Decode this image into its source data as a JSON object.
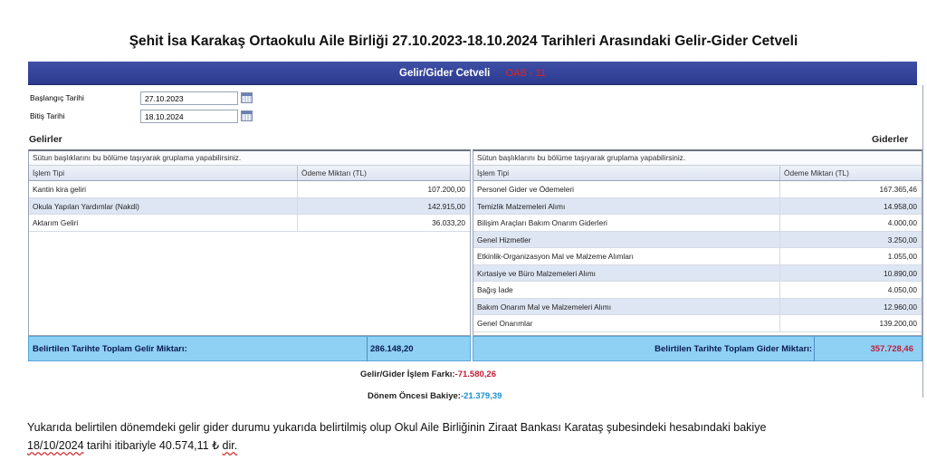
{
  "title": "Şehit İsa Karakaş Ortaokulu Aile Birliği 27.10.2023-18.10.2024 Tarihleri Arasındaki Gelir-Gider Cetveli",
  "header": {
    "label": "Gelir/Gider Cetveli",
    "badge": "OAB - 11"
  },
  "filters": {
    "start": {
      "label": "Başlangıç Tarihi",
      "value": "27.10.2023"
    },
    "end": {
      "label": "Bitiş Tarihi",
      "value": "18.10.2024"
    }
  },
  "income": {
    "heading": "Gelirler",
    "group_hint": "Sütun başlıklarını bu bölüme taşıyarak gruplama yapabilirsiniz.",
    "columns": [
      "İşlem Tipi",
      "Ödeme Miktarı (TL)"
    ],
    "rows": [
      {
        "type": "Kantin kira geliri",
        "amount": "107.200,00"
      },
      {
        "type": "Okula Yapılan Yardımlar (Nakdi)",
        "amount": "142.915,00"
      },
      {
        "type": "Aktarım Geliri",
        "amount": "36.033,20"
      }
    ],
    "total_label": "Belirtilen Tarihte Toplam Gelir Miktarı:",
    "total_value": "286.148,20"
  },
  "expense": {
    "heading": "Giderler",
    "group_hint": "Sütun başlıklarını bu bölüme taşıyarak gruplama yapabilirsiniz.",
    "columns": [
      "İşlem Tipi",
      "Ödeme Miktarı (TL)"
    ],
    "rows": [
      {
        "type": "Personel Gider ve Ödemeleri",
        "amount": "167.365,46"
      },
      {
        "type": "Temizlik Malzemeleri Alımı",
        "amount": "14.958,00"
      },
      {
        "type": "Bilişim Araçları Bakım Onarım Giderleri",
        "amount": "4.000,00"
      },
      {
        "type": "Genel Hizmetler",
        "amount": "3.250,00"
      },
      {
        "type": "Etkinlik-Organizasyon Mal ve Malzeme Alımları",
        "amount": "1.055,00"
      },
      {
        "type": "Kırtasiye ve Büro Malzemeleri Alımı",
        "amount": "10.890,00"
      },
      {
        "type": "Bağış İade",
        "amount": "4.050,00"
      },
      {
        "type": "Bakım Onarım Mal ve Malzemeleri Alımı",
        "amount": "12.960,00"
      },
      {
        "type": "Genel Onarımlar",
        "amount": "139.200,00"
      }
    ],
    "total_label": "Belirtilen Tarihte Toplam Gider Miktarı:",
    "total_value": "357.728,46"
  },
  "summary": {
    "diff_label": "Gelir/Gider İşlem Farkı:",
    "diff_value": "-71.580,26",
    "prev_label": "Dönem Öncesi Bakiye:",
    "prev_value": "-21.379,39"
  },
  "note": {
    "line1": "Yukarıda belirtilen dönemdeki gelir gider durumu yukarıda belirtilmiş olup Okul Aile Birliğinin Ziraat Bankası Karataş şubesindeki hesabındaki bakiye",
    "date": "18/10/2024",
    "line2_mid": " tarihi itibariyle 40.574,11 ₺ ",
    "line2_end": "dir."
  },
  "colors": {
    "header": "#2c3b8e",
    "total_bar": "#8fd0f5",
    "negative": "#c0203a",
    "positive_blue": "#1a8fcf"
  }
}
